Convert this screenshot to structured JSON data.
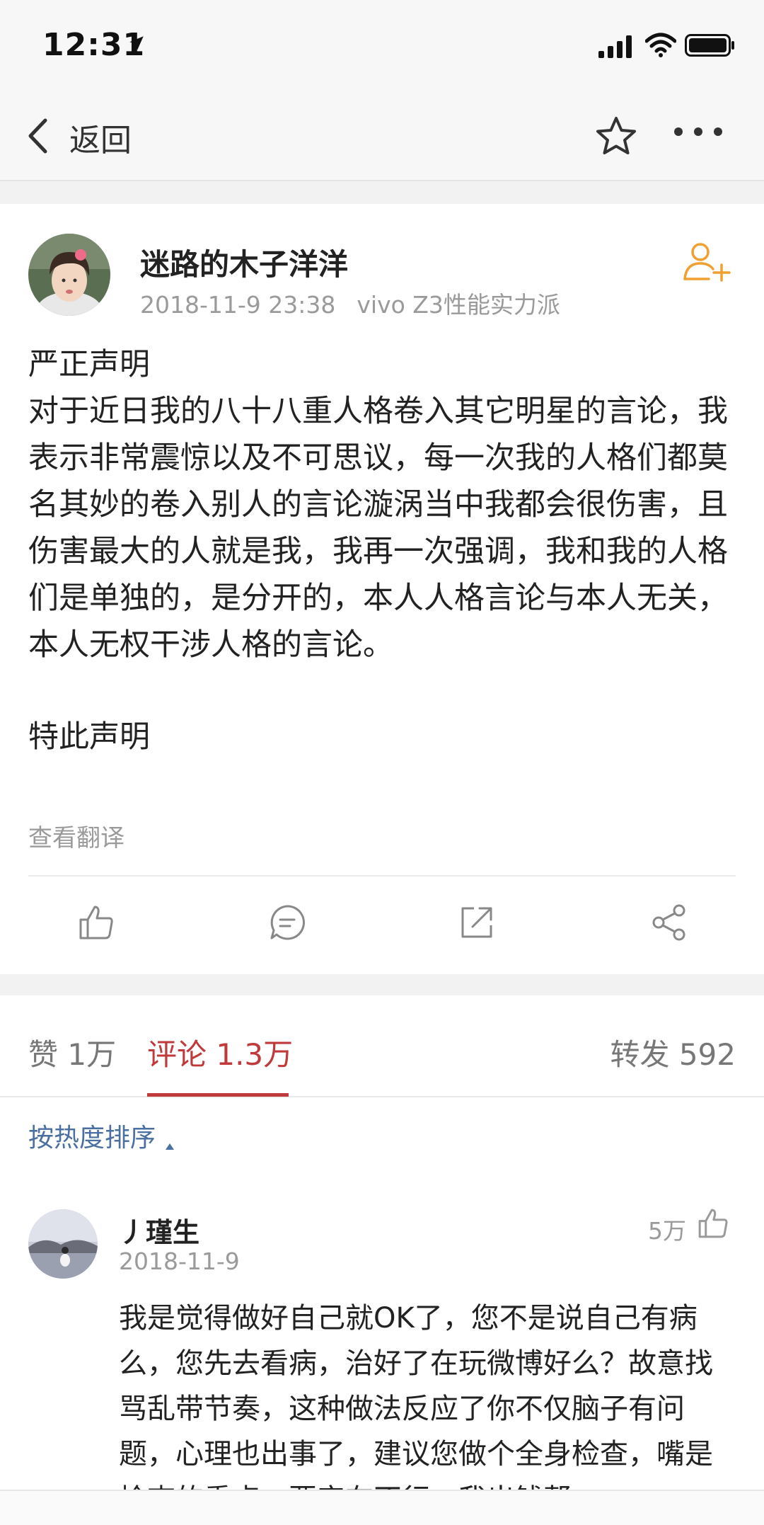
{
  "status_bar": {
    "time": "12:31"
  },
  "nav": {
    "back_label": "返回"
  },
  "post": {
    "username": "迷路的木子洋洋",
    "timestamp": "2018-11-9 23:38",
    "device": "vivo Z3性能实力派",
    "title": "严正声明",
    "body": "对于近日我的八十八重人格卷入其它明星的言论，我表示非常震惊以及不可思议，每一次我的人格们都莫名其妙的卷入别人的言论漩涡当中我都会很伤害，且伤害最大的人就是我，我再一次强调，我和我的人格们是单独的，是分开的，本人人格言论与本人无关，本人无权干涉人格的言论。",
    "closing": "特此声明",
    "translate_link": "查看翻译"
  },
  "tabs": {
    "likes": "赞 1万",
    "comments": "评论 1.3万",
    "reposts": "转发 592"
  },
  "sort": {
    "label": "按热度排序"
  },
  "comment": {
    "username": "丿瑾生",
    "date": "2018-11-9",
    "likes": "5万",
    "text": "我是觉得做好自己就OK了，您不是说自己有病么，您先去看病，治好了在玩微博好么？故意找骂乱带节奏，这种做法反应了你不仅脑子有问题，心理也出事了，建议您做个全身检查，嘴是检查的重点，要实在不行，我出钱帮"
  },
  "colors": {
    "accent_red": "#c0393b",
    "follow_orange": "#f0a030",
    "link_blue": "#4a6fa0",
    "meta_gray": "#9a9a9a"
  },
  "icons": [
    "location-arrow-icon",
    "signal-icon",
    "wifi-icon",
    "battery-icon",
    "back-chevron-icon",
    "star-icon",
    "more-icon",
    "add-friend-icon",
    "thumbs-up-icon",
    "comment-icon",
    "repost-icon",
    "share-icon"
  ]
}
